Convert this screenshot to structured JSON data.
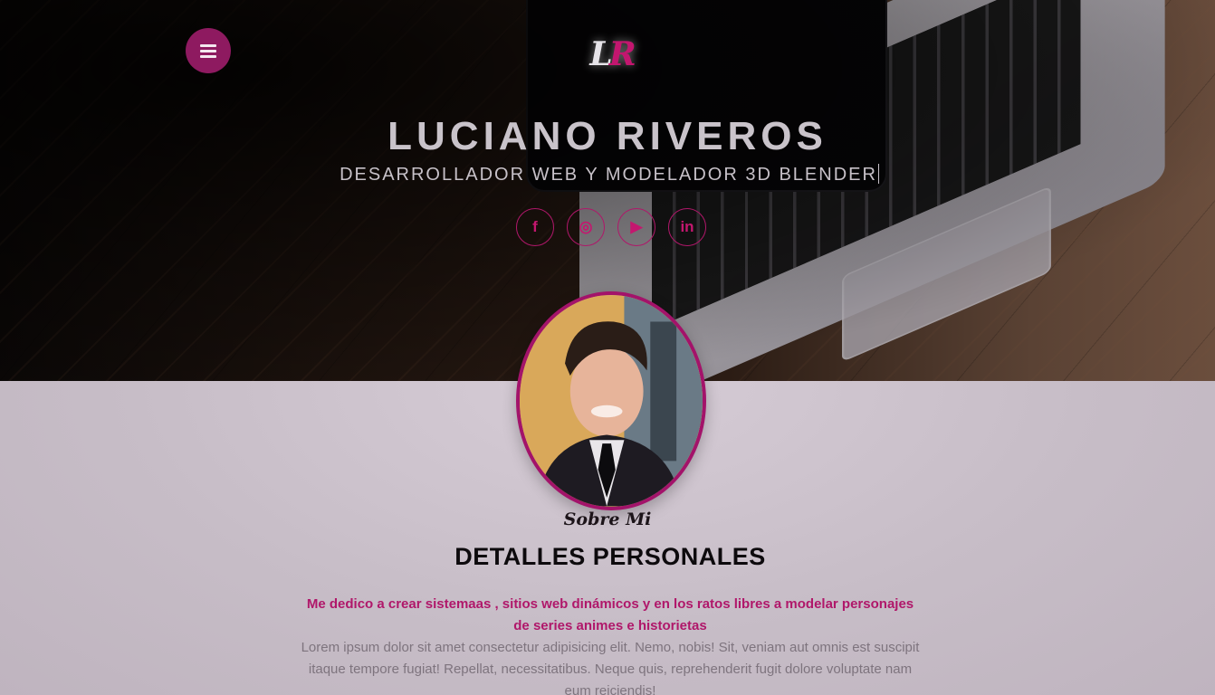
{
  "header": {
    "menu_icon": "hamburger-icon",
    "logo": {
      "letter1": "L",
      "letter2": "R"
    },
    "name": "LUCIANO RIVEROS",
    "subtitle": "DESARROLLADOR WEB Y MODELADOR 3D BLENDER",
    "socials": [
      {
        "icon": "facebook-icon",
        "glyph": "f"
      },
      {
        "icon": "instagram-icon",
        "glyph": "◎"
      },
      {
        "icon": "youtube-icon",
        "glyph": "▶"
      },
      {
        "icon": "linkedin-icon",
        "glyph": "in"
      }
    ]
  },
  "about": {
    "script_title": "Sobre Mi",
    "heading": "DETALLES PERSONALES",
    "lead": "Me dedico a crear sistemaas , sitios web dinámicos y en los ratos libres a modelar personajes de series animes e historietas",
    "body": "Lorem ipsum dolor sit amet consectetur adipisicing elit. Nemo, nobis! Sit, veniam aut omnis est suscipit itaque tempore fugiat! Repellat, necessitatibus. Neque quis, reprehenderit fugit dolore voluptate nam eum reiciendis!"
  },
  "colors": {
    "accent": "#b0176a",
    "menu_bg": "#8e1a60",
    "heading": "#0d0a0d",
    "body_text": "#7e747e"
  }
}
